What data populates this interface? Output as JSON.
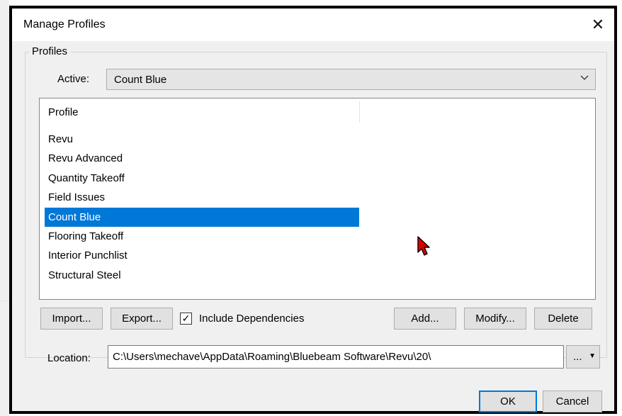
{
  "dialog": {
    "title": "Manage Profiles",
    "close_glyph": "✕",
    "group_label": "Profiles"
  },
  "active": {
    "label": "Active:",
    "value": "Count Blue",
    "arrow_glyph": "⌵"
  },
  "list": {
    "column_header": "Profile",
    "items": [
      "Revu",
      "Revu Advanced",
      "Quantity Takeoff",
      "Field Issues",
      "Count Blue",
      "Flooring Takeoff",
      "Interior Punchlist",
      "Structural Steel"
    ],
    "selected": "Count Blue"
  },
  "buttons": {
    "import": "Import...",
    "export": "Export...",
    "add": "Add...",
    "modify": "Modify...",
    "delete": "Delete",
    "ok": "OK",
    "cancel": "Cancel"
  },
  "include_dependencies": {
    "label": "Include Dependencies",
    "checked": true,
    "check_glyph": "✓"
  },
  "location": {
    "label": "Location:",
    "value": "C:\\Users\\mechave\\AppData\\Roaming\\Bluebeam Software\\Revu\\20\\",
    "browse_label": "...",
    "browse_arrow": "▼"
  },
  "colors": {
    "selection": "#0078d7",
    "dialog_bg": "#f0f0f0",
    "cursor": "#e00000"
  },
  "icons": {
    "cursor": "red-arrow-cursor-icon",
    "close": "close-icon",
    "dropdown": "chevron-down-icon"
  }
}
